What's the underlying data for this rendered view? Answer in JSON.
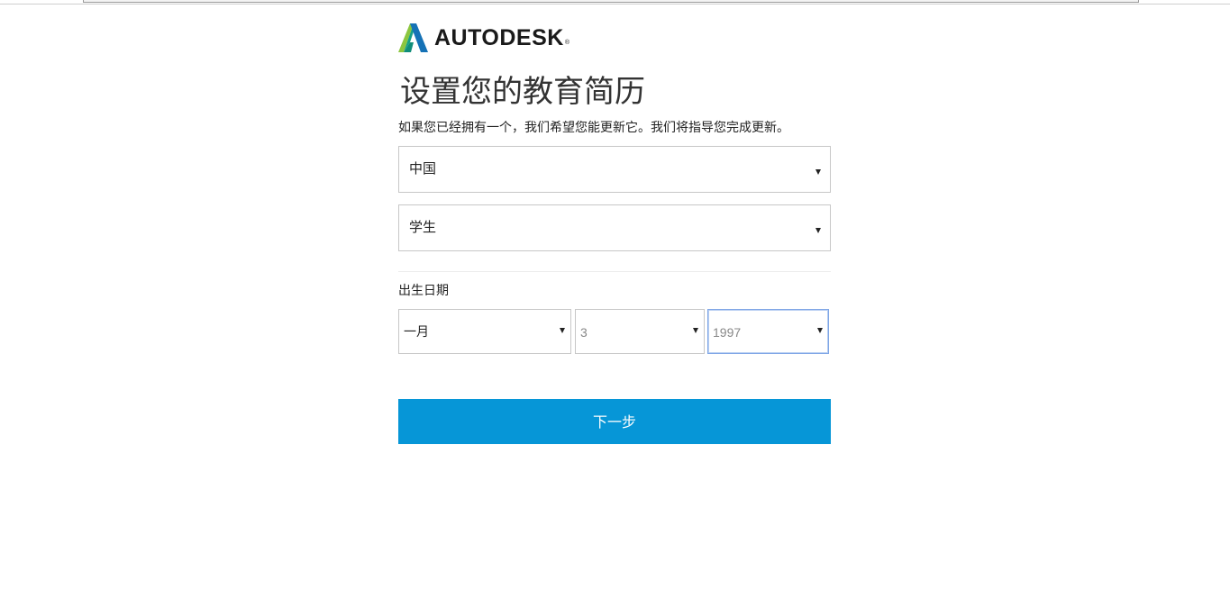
{
  "brand": {
    "logo_text": "AUTODESK",
    "registered_mark": "®",
    "logo_icon": "autodesk-a-logo",
    "colors": {
      "logo_light": "#8cc63f",
      "logo_mid": "#16a085",
      "logo_dark": "#1572b6"
    }
  },
  "page": {
    "title": "设置您的教育简历",
    "subtitle": "如果您已经拥有一个，我们希望您能更新它。我们将指导您完成更新。"
  },
  "form": {
    "country": {
      "value": "中国"
    },
    "role": {
      "value": "学生"
    },
    "dob": {
      "label": "出生日期",
      "month": "一月",
      "day": "3",
      "year": "1997"
    },
    "next_label": "下一步"
  },
  "colors": {
    "accent": "#0696d7",
    "focus_border": "#7fa6e6",
    "border": "#c7c7c7"
  }
}
